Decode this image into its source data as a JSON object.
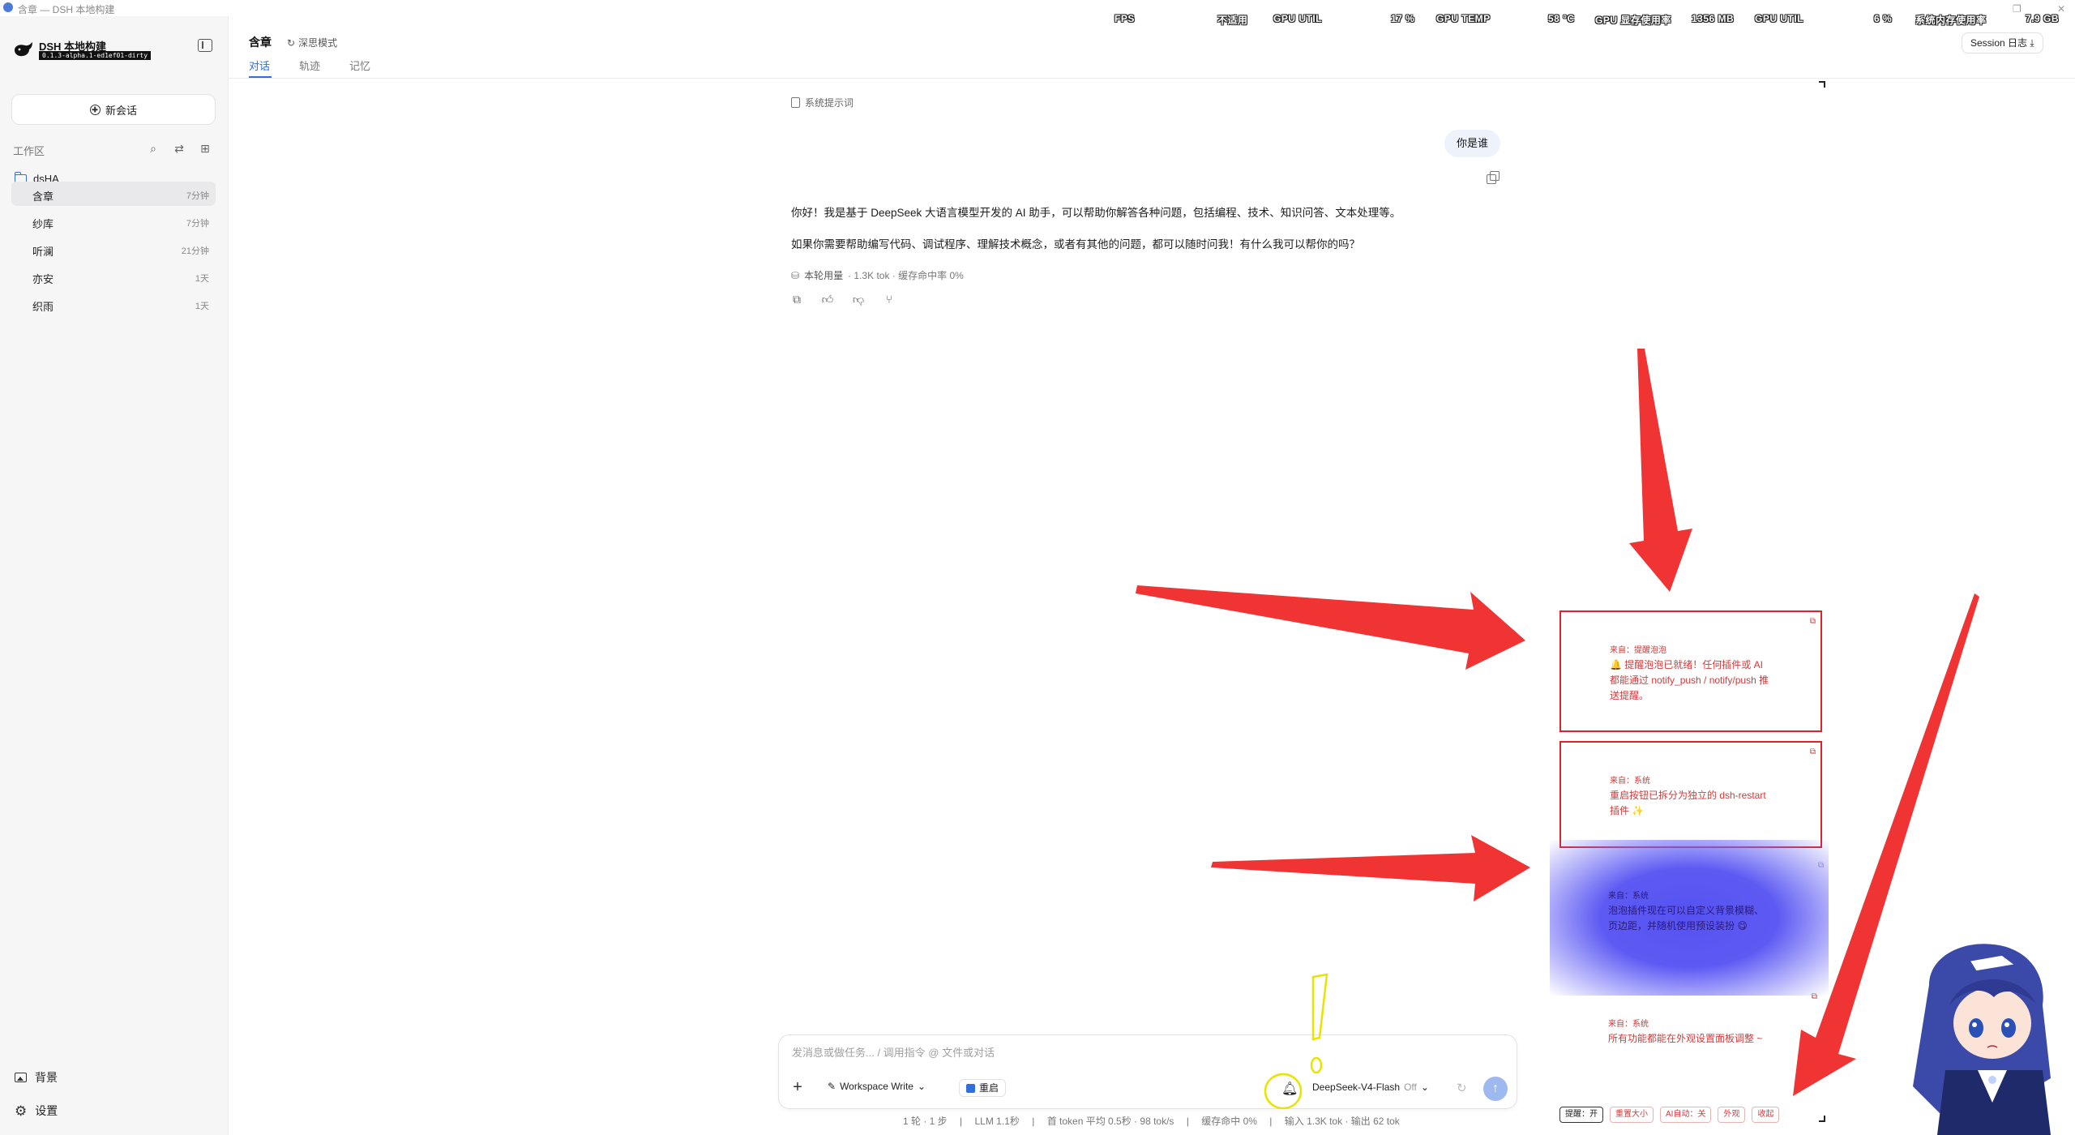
{
  "window": {
    "title": "含章 — DSH 本地构建",
    "restore_glyph": "❐",
    "close_glyph": "✕"
  },
  "hud": {
    "fps_label": "FPS",
    "fps_value": "不适用",
    "gpu1_label": "GPU UTIL",
    "gpu1_value": "17 %",
    "temp_label": "GPU TEMP",
    "temp_value": "58 °C",
    "vram_label": "GPU 显存使用率",
    "vram_value": "1356 MB",
    "gpu2_label": "GPU UTIL",
    "gpu2_value": "6 %",
    "mem_label": "系统内存使用率",
    "mem_value": "7.9 GB"
  },
  "sidebar": {
    "app_name": "DSH 本地构建",
    "app_version": "0.1.3-alpha.1-ed1ef01-dirty",
    "new_chat_label": "新会话",
    "workspace_label": "工作区",
    "project_name": "dsHA",
    "sessions": [
      {
        "name": "含章",
        "time": "7分钟",
        "active": true
      },
      {
        "name": "纱库",
        "time": "7分钟",
        "active": false
      },
      {
        "name": "听澜",
        "time": "21分钟",
        "active": false
      },
      {
        "name": "亦安",
        "time": "1天",
        "active": false
      },
      {
        "name": "织雨",
        "time": "1天",
        "active": false
      }
    ],
    "background_label": "背景",
    "settings_label": "设置"
  },
  "header": {
    "title": "含章",
    "focus_mode_label": "深思模式",
    "tabs": [
      "对话",
      "轨迹",
      "记忆"
    ],
    "active_tab": 0,
    "session_log_label": "Session 日志"
  },
  "chat": {
    "system_prompt_label": "系统提示词",
    "user_message": "你是谁",
    "reply_paragraphs": [
      "你好！我是基于 DeepSeek 大语言模型开发的 AI 助手，可以帮助你解答各种问题，包括编程、技术、知识问答、文本处理等。",
      "如果你需要帮助编写代码、调试程序、理解技术概念，或者有其他的问题，都可以随时问我！有什么我可以帮你的吗？"
    ],
    "usage_label": "本轮用量",
    "usage_detail": "1.3K tok · 缓存命中率 0%"
  },
  "composer": {
    "placeholder": "发消息或做任务... / 调用指令 @ 文件或对话",
    "workspace_mode": "Workspace Write",
    "restart_label": "重启",
    "model_name": "DeepSeek-V4-Flash",
    "model_thinking": "Off"
  },
  "status_bar": [
    "1 轮 · 1 步",
    "|",
    "LLM 1.1秒",
    "|",
    "首 token 平均 0.5秒 · 98 tok/s",
    "|",
    "缓存命中 0%",
    "|",
    "输入 1.3K tok · 输出 62 tok"
  ],
  "notifications": [
    {
      "source": "来自：提醒泡泡",
      "message": "🔔 提醒泡泡已就绪！任何插件或 AI 都能通过 notify_push / notify/push 推送提醒。"
    },
    {
      "source": "来自：系统",
      "message": "重启按钮已拆分为独立的 dsh-restart 插件 ✨"
    },
    {
      "source": "来自：系统",
      "message": "泡泡插件现在可以自定义背景模糊、页边距，并随机使用预设装扮 😋"
    },
    {
      "source": "来自：系统",
      "message": "所有功能都能在外观设置面板调整 ~"
    }
  ],
  "notify_toolbar": {
    "reminder_toggle": "提醒：开",
    "reset_size": "重置大小",
    "ai_push_toggle": "AI自动：关",
    "appearance": "外观",
    "collapse": "收起"
  },
  "colors": {
    "accent": "#2f6fe0",
    "annotation_red": "#f03434",
    "highlight_yellow": "#e8e400",
    "bubble_blue": "#5652f2"
  }
}
